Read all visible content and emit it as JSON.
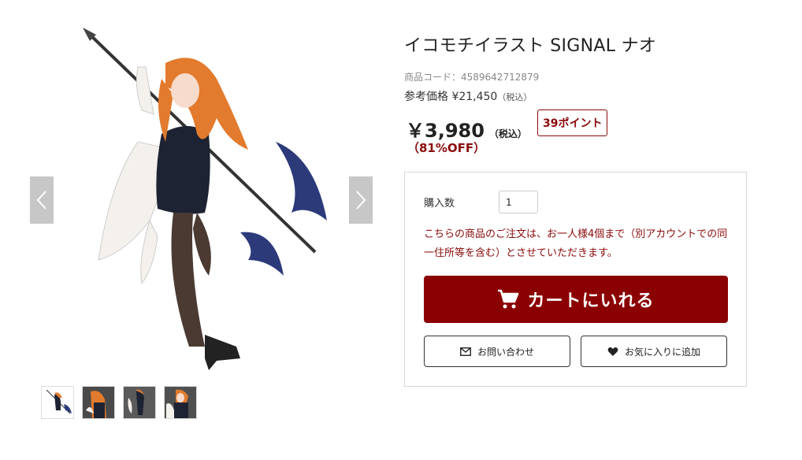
{
  "product": {
    "title": "イコモチイラスト SIGNAL ナオ",
    "code_label": "商品コード：4589642712879",
    "reference_price": "参考価格 ¥21,450",
    "reference_tax": "（税込）",
    "price": "￥3,980",
    "price_tax": "（税込）",
    "discount": "（81%OFF）",
    "points": "39ポイント"
  },
  "gallery": {
    "prev_icon": "chevron-left-icon",
    "next_icon": "chevron-right-icon",
    "thumbnail_count": 4
  },
  "cart": {
    "quantity_label": "購入数",
    "quantity_value": "1",
    "notice": "こちらの商品のご注文は、お一人様4個まで（別アカウントでの同一住所等を含む）とさせていただきます。",
    "add_to_cart_label": "カートにいれる",
    "add_to_cart_icon": "cart-icon",
    "inquiry_label": "お問い合わせ",
    "inquiry_icon": "mail-icon",
    "favorite_label": "お気に入りに追加",
    "favorite_icon": "heart-icon"
  },
  "colors": {
    "accent": "#8b0000",
    "arrow_bg": "#c7c7c7",
    "border": "#d6d6d6"
  }
}
